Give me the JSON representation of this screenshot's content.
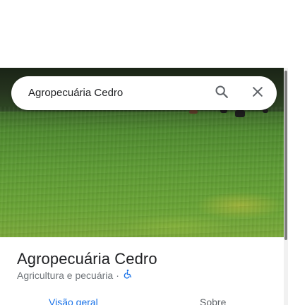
{
  "search": {
    "value": "Agropecuária Cedro"
  },
  "place": {
    "name": "Agropecuária Cedro",
    "category": "Agricultura e pecuária",
    "separator": "·",
    "accessibility_icon": "wheelchair-icon"
  },
  "tabs": [
    {
      "label": "Visão geral",
      "active": true
    },
    {
      "label": "Sobre",
      "active": false
    }
  ],
  "icons": {
    "search": "search-icon",
    "close": "close-icon"
  },
  "colors": {
    "active_tab": "#1a73e8",
    "accessibility": "#1a73e8",
    "title": "#202124",
    "subtitle": "#70757a"
  }
}
